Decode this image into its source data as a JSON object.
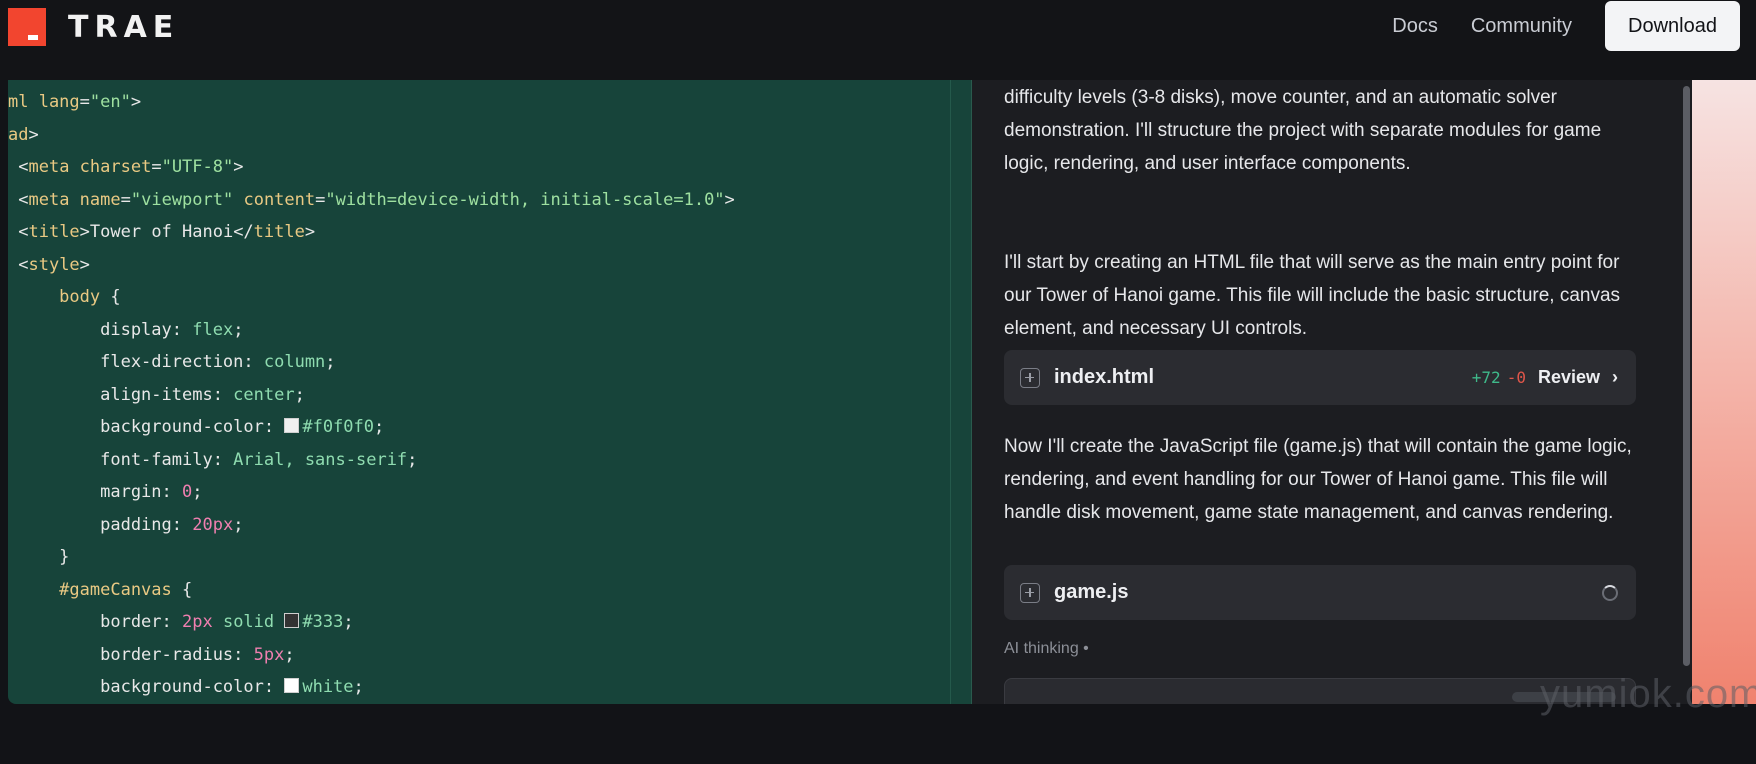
{
  "brand": {
    "logo_text": "TRAE",
    "accent": "#f2452f"
  },
  "nav": {
    "links": [
      "Docs",
      "Community"
    ],
    "download_label": "Download"
  },
  "editor": {
    "background": "#17443a",
    "lines": [
      [
        [
          "tag",
          "ml lang"
        ],
        [
          "prop",
          "="
        ],
        [
          "str",
          "\"en\""
        ],
        [
          "prop",
          ">"
        ]
      ],
      [
        [
          "tag",
          "ad"
        ],
        [
          "prop",
          ">"
        ]
      ],
      [
        [
          "prop",
          " <"
        ],
        [
          "tag",
          "meta "
        ],
        [
          "attr",
          "charset"
        ],
        [
          "prop",
          "="
        ],
        [
          "str",
          "\"UTF-8\""
        ],
        [
          "prop",
          ">"
        ]
      ],
      [
        [
          "prop",
          " <"
        ],
        [
          "tag",
          "meta "
        ],
        [
          "attr",
          "name"
        ],
        [
          "prop",
          "="
        ],
        [
          "str",
          "\"viewport\" "
        ],
        [
          "attr",
          "content"
        ],
        [
          "prop",
          "="
        ],
        [
          "str",
          "\"width=device-width, initial-scale=1.0\""
        ],
        [
          "prop",
          ">"
        ]
      ],
      [
        [
          "prop",
          " <"
        ],
        [
          "tag",
          "title"
        ],
        [
          "prop",
          ">Tower of Hanoi</"
        ],
        [
          "tag",
          "title"
        ],
        [
          "prop",
          ">"
        ]
      ],
      [
        [
          "prop",
          " <"
        ],
        [
          "tag",
          "style"
        ],
        [
          "prop",
          ">"
        ]
      ],
      [
        [
          "sel",
          "     body "
        ],
        [
          "prop",
          "{"
        ]
      ],
      [
        [
          "prop",
          "         display: "
        ],
        [
          "val",
          "flex"
        ],
        [
          "prop",
          ";"
        ]
      ],
      [
        [
          "prop",
          "         flex-direction: "
        ],
        [
          "val",
          "column"
        ],
        [
          "prop",
          ";"
        ]
      ],
      [
        [
          "prop",
          "         align-items: "
        ],
        [
          "val",
          "center"
        ],
        [
          "prop",
          ";"
        ]
      ],
      [
        [
          "prop",
          "         background-color: "
        ],
        [
          "swatch",
          "#f0f0f0"
        ],
        [
          "val",
          "#f0f0f0"
        ],
        [
          "prop",
          ";"
        ]
      ],
      [
        [
          "prop",
          "         font-family: "
        ],
        [
          "val",
          "Arial, sans-serif"
        ],
        [
          "prop",
          ";"
        ]
      ],
      [
        [
          "prop",
          "         margin: "
        ],
        [
          "num",
          "0"
        ],
        [
          "prop",
          ";"
        ]
      ],
      [
        [
          "prop",
          "         padding: "
        ],
        [
          "num",
          "20px"
        ],
        [
          "prop",
          ";"
        ]
      ],
      [
        [
          "prop",
          "     }"
        ]
      ],
      [
        [
          "sel",
          "     #gameCanvas "
        ],
        [
          "prop",
          "{"
        ]
      ],
      [
        [
          "prop",
          "         border: "
        ],
        [
          "num",
          "2px "
        ],
        [
          "val",
          "solid "
        ],
        [
          "swatch",
          "#333333"
        ],
        [
          "val",
          "#333"
        ],
        [
          "prop",
          ";"
        ]
      ],
      [
        [
          "prop",
          "         border-radius: "
        ],
        [
          "num",
          "5px"
        ],
        [
          "prop",
          ";"
        ]
      ],
      [
        [
          "prop",
          "         background-color: "
        ],
        [
          "swatch",
          "#ffffff"
        ],
        [
          "val",
          "white"
        ],
        [
          "prop",
          ";"
        ]
      ]
    ]
  },
  "chat": {
    "para1": "JavaScript for game logic. The game will include features like multiple difficulty levels (3-8 disks), move counter, and an automatic solver demonstration. I'll structure the project with separate modules for game logic, rendering, and user interface components.",
    "para2": "I'll start by creating an HTML file that will serve as the main entry point for our Tower of Hanoi game. This file will include the basic structure, canvas element, and necessary UI controls.",
    "file1": {
      "name": "index.html",
      "added": "+72",
      "removed": "-0",
      "action": "Review"
    },
    "para3": "Now I'll create the JavaScript file (game.js) that will contain the game logic, rendering, and event handling for our Tower of Hanoi game. This file will handle disk movement, game state management, and canvas rendering.",
    "file2": {
      "name": "game.js"
    },
    "thinking_label": "AI thinking •"
  },
  "watermark": "yumiok.com"
}
